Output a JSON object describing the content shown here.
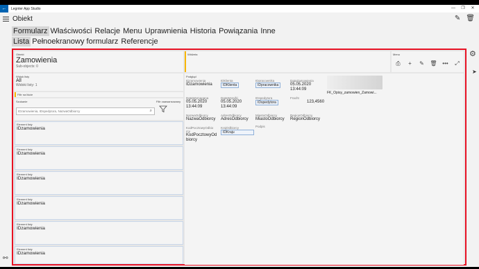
{
  "window": {
    "title": "Legnter App Studio",
    "back_glyph": "←",
    "controls": [
      "—",
      "❐",
      "✕"
    ]
  },
  "appbar": {
    "title": "Obiekt",
    "edit_glyph": "✎",
    "delete_glyph": "🗑"
  },
  "tabs_row1": [
    "Formularz",
    "Właściwości",
    "Relacje",
    "Menu",
    "Uprawnienia",
    "Historia",
    "Powiązania",
    "Inne"
  ],
  "tabs_row2": [
    "Lista",
    "Pełnoekranowy formularz",
    "Referencje"
  ],
  "active_tabs": [
    "Formularz",
    "Lista"
  ],
  "objekt": {
    "label": "Obiekt",
    "name": "Zamowienia",
    "sub": "Sub-objects: 0"
  },
  "widok": {
    "label": "Widok listy",
    "value": "All",
    "count": "Widoki listy: 1"
  },
  "filtr": {
    "label": "Filtr na liście"
  },
  "szukanie": {
    "label": "Szukanie",
    "placeholder": "IDzamowienia, IDspedytora, NazwaOdbiorcy",
    "filter_label": "Filtr zaawansowany"
  },
  "list_items": [
    {
      "label": "Element listy",
      "value": "IDzamowienia"
    },
    {
      "label": "Element listy",
      "value": "IDzamowienia"
    },
    {
      "label": "Element listy",
      "value": "IDzamowienia"
    },
    {
      "label": "Element listy",
      "value": "IDzamowienia"
    },
    {
      "label": "Element listy",
      "value": "IDzamowienia"
    },
    {
      "label": "Element listy",
      "value": "IDzamowienia"
    }
  ],
  "widget": {
    "label": "Widżeta"
  },
  "menu": {
    "label": "Menu",
    "icons": [
      "print-icon",
      "add-icon",
      "edit-icon",
      "delete-icon",
      "more-icon",
      "expand-icon"
    ],
    "glyphs": [
      "⎙",
      "+",
      "✎",
      "🗑",
      "•••",
      "⤢"
    ]
  },
  "podglad": {
    "label": "Podgląd",
    "fields": {
      "idzamowienia": {
        "l": "IDzamowienia",
        "v": "IDzamowienia"
      },
      "idklienta": {
        "l": "IDklienta",
        "v": "IDKlienta"
      },
      "idpracownika": {
        "l": "IDpracownika",
        "v": "IDpracownika"
      },
      "datazamowienia": {
        "l": "DataZamowienia",
        "v1": "05.05.2020",
        "v2": "13:44:09"
      },
      "datawymagana": {
        "l": "DataWymagana",
        "v1": "05.05.2020",
        "v2": "13:44:09"
      },
      "datawysylki": {
        "l": "DataWysylki",
        "v1": "05.05.2020",
        "v2": "13:44:09"
      },
      "idspedytora": {
        "l": "IDspedytora",
        "v": "IDspedytora"
      },
      "fracht": {
        "l": "Fracht",
        "v": "123,4560"
      },
      "nazwaodbiorcy": {
        "l": "NazwaOdbiorcy",
        "v": "NazwaOdbiorcy"
      },
      "adresodbiorcy": {
        "l": "AdresOdbiorcy",
        "v": "AdresOdbiorcy"
      },
      "miastoodbiorcy": {
        "l": "MiastoOdbiorcy",
        "v": "MiastoOdbiorcy"
      },
      "regionodbiorcy": {
        "l": "RegionOdbiorcy",
        "v": "RegionOdbiorcy"
      },
      "kodpocztowy": {
        "l1": "KodPocztowyOdbio",
        "l2": "rcy",
        "v1": "KodPocztowyOd",
        "v2": "biorcy"
      },
      "krajodbiorcy": {
        "l": "KrajOdbiorcy",
        "v": "IDKraju"
      },
      "podpis": {
        "l": "Podpis"
      }
    },
    "attachment": "FK_Opisy_zamowien_Zamowi..."
  }
}
